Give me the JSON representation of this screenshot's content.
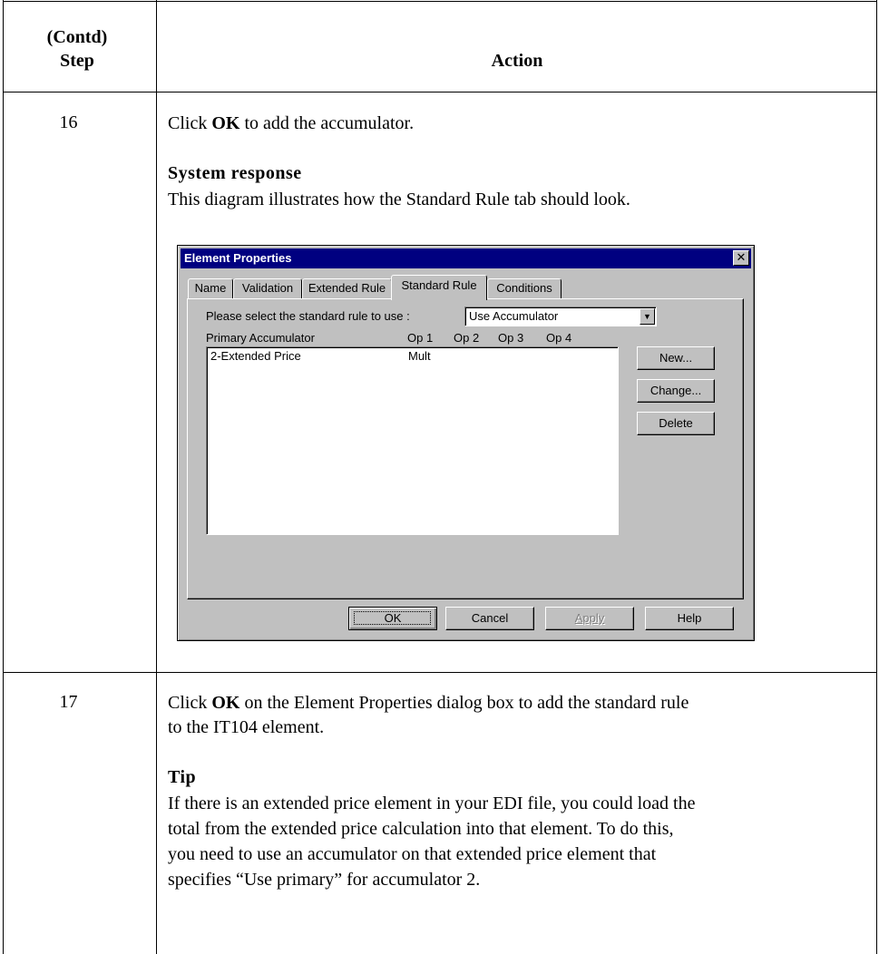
{
  "table": {
    "header_step_line1": "(Contd)",
    "header_step_line2": "Step",
    "header_action": "Action"
  },
  "rows": [
    {
      "step": "16",
      "intro_pre": "Click ",
      "intro_bold": "OK",
      "intro_post": " to add the accumulator.",
      "subhead": "System response",
      "description": "This diagram illustrates how the Standard Rule tab should look."
    },
    {
      "step": "17",
      "intro_pre": "Click ",
      "intro_bold": "OK",
      "intro_post_line1": " on the Element Properties dialog box to add the standard rule",
      "intro_post_line2": "to the IT104 element.",
      "subhead": "Tip",
      "tip_lines": [
        "If there is an extended price element in your EDI file, you could load the",
        "total from the extended price calculation into that element. To do this,",
        "you need to use an accumulator on that extended price element that",
        "specifies “Use primary” for accumulator 2."
      ]
    }
  ],
  "dialog": {
    "title": "Element Properties",
    "close_glyph": "✕",
    "tabs": [
      "Name",
      "Validation",
      "Extended Rule",
      "Standard Rule",
      "Conditions"
    ],
    "active_tab": "Standard Rule",
    "select_label": "Please select the standard rule to use :",
    "select_value": "Use Accumulator",
    "select_arrow": "▼",
    "columns": [
      "Primary Accumulator",
      "Op 1",
      "Op 2",
      "Op 3",
      "Op 4"
    ],
    "list_rows": [
      {
        "primary": "2-Extended Price",
        "op1": "Mult",
        "op2": "",
        "op3": "",
        "op4": ""
      }
    ],
    "side_buttons": {
      "new": "New...",
      "change": "Change...",
      "delete": "Delete"
    },
    "footer_buttons": {
      "ok": "OK",
      "cancel": "Cancel",
      "apply": "Apply",
      "help": "Help"
    }
  },
  "colors": {
    "titlebar": "#000080",
    "dialog_face": "#c0c0c0"
  }
}
